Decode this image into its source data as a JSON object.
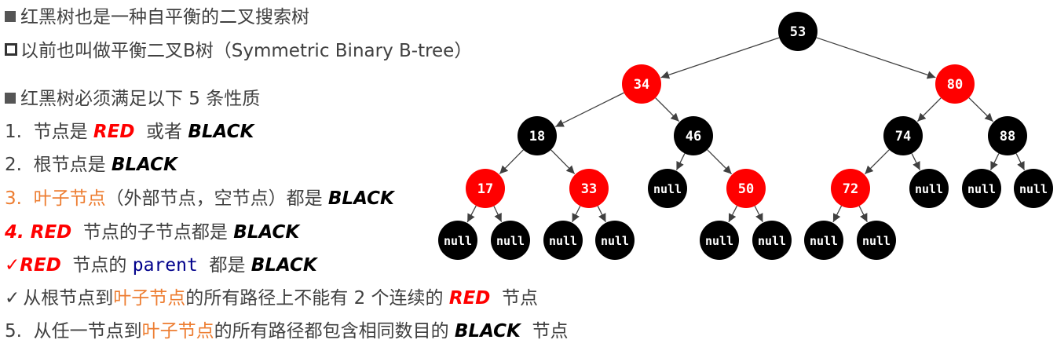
{
  "lines": {
    "l1_text": "红黑树也是一种自平衡的二叉搜索树",
    "l2_text": "以前也叫做平衡二叉B树（Symmetric Binary B-tree）",
    "l3_text": "红黑树必须满足以下 5 条性质",
    "l4_prefix": "1.  节点是 ",
    "l4_red": "RED",
    "l4_mid": "  或者 ",
    "l4_black": "BLACK",
    "l5_prefix": "2.  根节点是 ",
    "l5_black": "BLACK",
    "l6_prefix": "3.  叶子节点",
    "l6_mid": "（外部节点，空节点）都是 ",
    "l6_black": "BLACK",
    "l7_prefix": "4. ",
    "l7_red": "RED",
    "l7_mid": "  节点的子节点都是 ",
    "l7_black": "BLACK",
    "l8_check": "✓",
    "l8_red": "RED",
    "l8_mid": "  节点的 ",
    "l8_code": "parent",
    "l8_mid2": "  都是 ",
    "l8_black": "BLACK",
    "l9_check": "✓",
    "l9_a": "从根节点到",
    "l9_leaf": "叶子节点",
    "l9_b": "的所有路径上不能有 2 个连续的 ",
    "l9_red": "RED",
    "l9_c": "  节点",
    "l10_a": "5.  从任一节点到",
    "l10_leaf": "叶子节点",
    "l10_b": "的所有路径都包含相同数目的 ",
    "l10_black": "BLACK",
    "l10_c": "  节点"
  },
  "icons": {
    "bullet_filled": "filled-square-icon",
    "bullet_hollow": "hollow-square-icon",
    "check": "check-icon"
  },
  "colors": {
    "red_node": "#ff0000",
    "black_node": "#000000",
    "edge": "#404040",
    "node_text": "#ffffff",
    "highlight_orange": "#ed7d31"
  },
  "tree": {
    "nodes": [
      {
        "id": "n53",
        "label": "53",
        "color": "black"
      },
      {
        "id": "n34",
        "label": "34",
        "color": "red"
      },
      {
        "id": "n80",
        "label": "80",
        "color": "red"
      },
      {
        "id": "n18",
        "label": "18",
        "color": "black"
      },
      {
        "id": "n46",
        "label": "46",
        "color": "black"
      },
      {
        "id": "n74",
        "label": "74",
        "color": "black"
      },
      {
        "id": "n88",
        "label": "88",
        "color": "black"
      },
      {
        "id": "n17",
        "label": "17",
        "color": "red"
      },
      {
        "id": "n33",
        "label": "33",
        "color": "red"
      },
      {
        "id": "null46L",
        "label": "null",
        "color": "black"
      },
      {
        "id": "n50",
        "label": "50",
        "color": "red"
      },
      {
        "id": "n72",
        "label": "72",
        "color": "red"
      },
      {
        "id": "null74R",
        "label": "null",
        "color": "black"
      },
      {
        "id": "null88L",
        "label": "null",
        "color": "black"
      },
      {
        "id": "null88R",
        "label": "null",
        "color": "black"
      },
      {
        "id": "null17L",
        "label": "null",
        "color": "black"
      },
      {
        "id": "null17R",
        "label": "null",
        "color": "black"
      },
      {
        "id": "null33L",
        "label": "null",
        "color": "black"
      },
      {
        "id": "null33R",
        "label": "null",
        "color": "black"
      },
      {
        "id": "null50L",
        "label": "null",
        "color": "black"
      },
      {
        "id": "null50R",
        "label": "null",
        "color": "black"
      },
      {
        "id": "null72L",
        "label": "null",
        "color": "black"
      },
      {
        "id": "null72R",
        "label": "null",
        "color": "black"
      }
    ],
    "edges": [
      [
        "n53",
        "n34"
      ],
      [
        "n53",
        "n80"
      ],
      [
        "n34",
        "n18"
      ],
      [
        "n34",
        "n46"
      ],
      [
        "n80",
        "n74"
      ],
      [
        "n80",
        "n88"
      ],
      [
        "n18",
        "n17"
      ],
      [
        "n18",
        "n33"
      ],
      [
        "n46",
        "null46L"
      ],
      [
        "n46",
        "n50"
      ],
      [
        "n74",
        "n72"
      ],
      [
        "n74",
        "null74R"
      ],
      [
        "n88",
        "null88L"
      ],
      [
        "n88",
        "null88R"
      ],
      [
        "n17",
        "null17L"
      ],
      [
        "n17",
        "null17R"
      ],
      [
        "n33",
        "null33L"
      ],
      [
        "n33",
        "null33R"
      ],
      [
        "n50",
        "null50L"
      ],
      [
        "n50",
        "null50R"
      ],
      [
        "n72",
        "null72L"
      ],
      [
        "n72",
        "null72R"
      ]
    ]
  }
}
